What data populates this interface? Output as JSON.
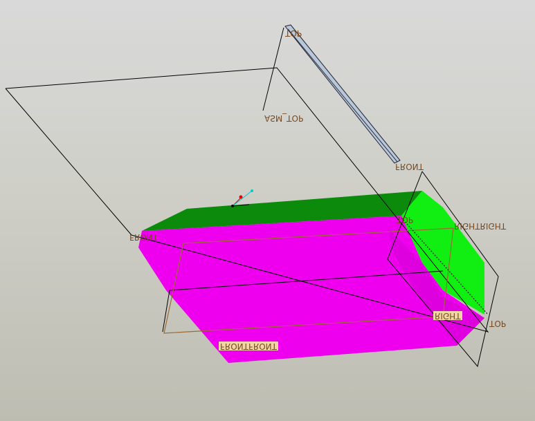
{
  "colors": {
    "top_face": "#0b8a0b",
    "front_face": "#ee00ee",
    "right_face": "#11ee11",
    "datum_plane": "#000000",
    "sketch": "#9a6a32",
    "label_text": "#7a4a1e",
    "label_box": "#f1d7a6"
  },
  "labels": {
    "top_1": "TOP",
    "asm_top": "ASM_TOP",
    "front_1": "FRONT",
    "front_2": "FRONT",
    "top_2": "TOP",
    "right_right": "RIGHTRIGHT",
    "right": "RIGHT",
    "top_3": "TOP",
    "frontfront": "FRONTFRONT"
  }
}
